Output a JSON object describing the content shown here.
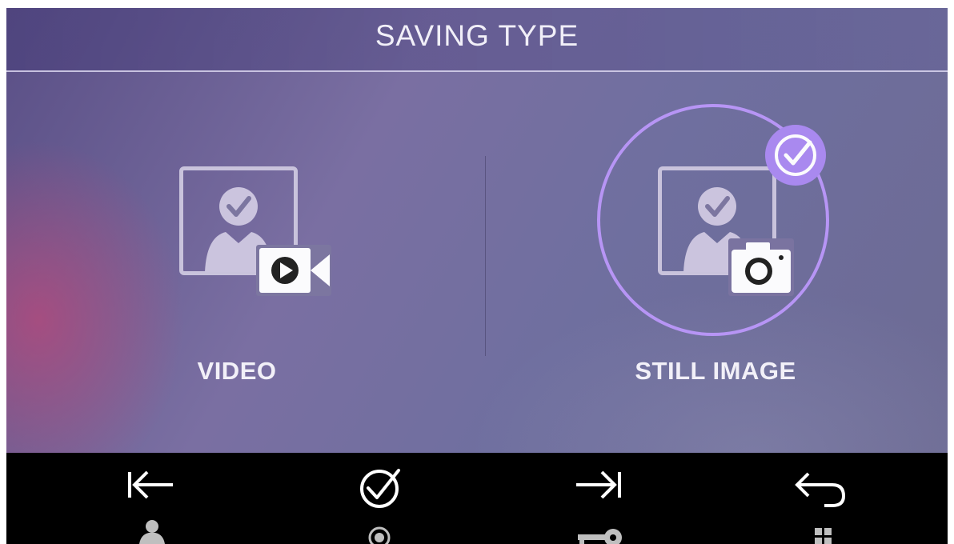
{
  "header": {
    "title": "SAVING TYPE"
  },
  "options": [
    {
      "label": "VIDEO",
      "icon": "video-camera-icon",
      "selected": false
    },
    {
      "label": "STILL IMAGE",
      "icon": "photo-camera-icon",
      "selected": true
    }
  ],
  "bottom_bar": {
    "buttons": [
      {
        "name": "previous",
        "icon": "arrow-left-to-bar-icon",
        "sub_icon": "person-icon"
      },
      {
        "name": "confirm",
        "icon": "check-circle-icon",
        "sub_icon": "record-icon"
      },
      {
        "name": "next",
        "icon": "arrow-right-to-bar-icon",
        "sub_icon": "key-icon"
      },
      {
        "name": "back",
        "icon": "return-arrow-icon",
        "sub_icon": "grid-icon"
      }
    ]
  },
  "colors": {
    "accent": "#a989ef",
    "ring": "#b795f5",
    "bar": "#000000",
    "text": "#f2f0f8"
  }
}
